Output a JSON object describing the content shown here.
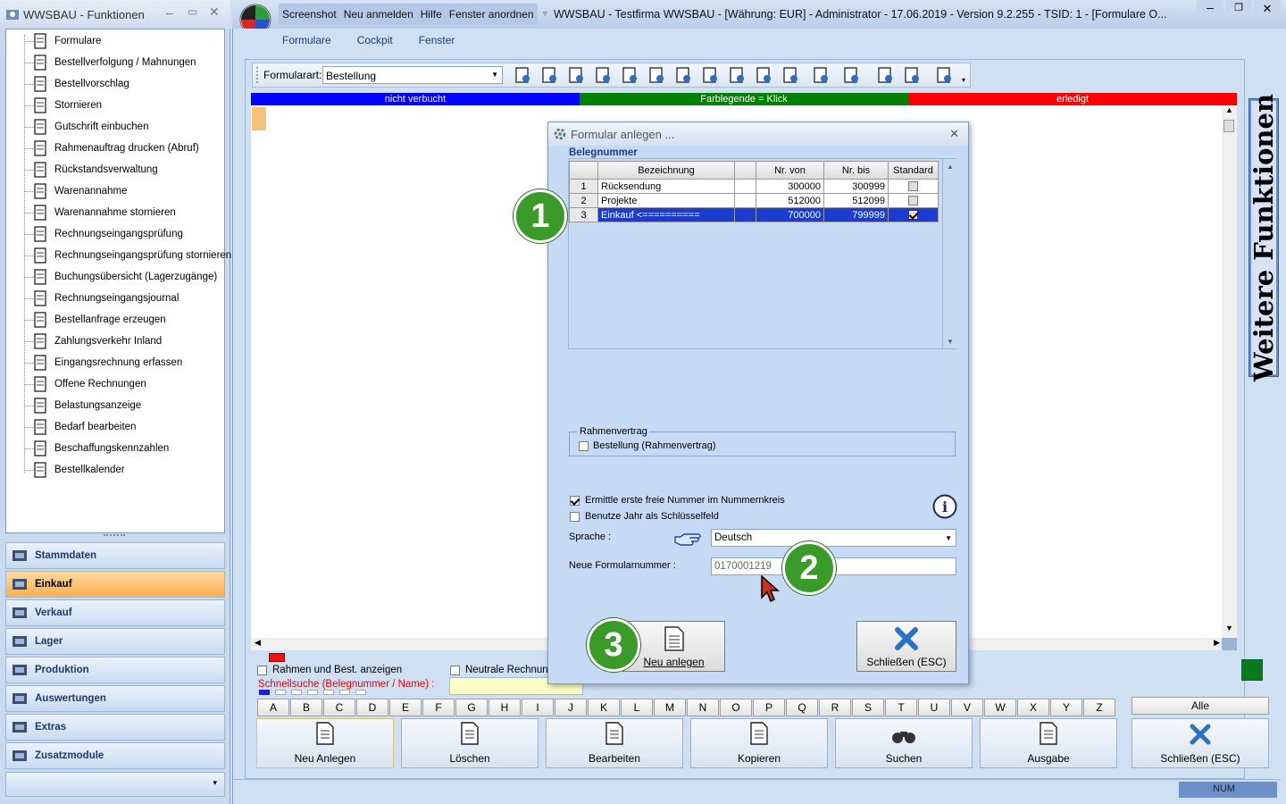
{
  "left_window": {
    "title": "WWSBAU - Funktionen",
    "tree_items": [
      "Formulare",
      "Bestellverfolgung / Mahnungen",
      "Bestellvorschlag",
      "Stornieren",
      "Gutschrift einbuchen",
      "Rahmenauftrag drucken (Abruf)",
      "Rückstandsverwaltung",
      "Warenannahme",
      "Warenannahme stornieren",
      "Rechnungseingangsprüfung",
      "Rechnungseingangsprüfung stornieren",
      "Buchungsübersicht (Lagerzugänge)",
      "Rechnungseingangsjournal",
      "Bestellanfrage erzeugen",
      "Zahlungsverkehr Inland",
      "Eingangsrechnung erfassen",
      "Offene Rechnungen",
      "Belastungsanzeige",
      "Bedarf bearbeiten",
      "Beschaffungskennzahlen",
      "Bestellkalender"
    ],
    "nav_groups": [
      "Stammdaten",
      "Einkauf",
      "Verkauf",
      "Lager",
      "Produktion",
      "Auswertungen",
      "Extras",
      "Zusatzmodule"
    ],
    "active_group": "Einkauf"
  },
  "main_window": {
    "top_menu": [
      "Screenshot",
      "Neu anmelden",
      "Hilfe",
      "Fenster anordnen"
    ],
    "title": "WWSBAU - Testfirma WWSBAU - [Währung: EUR] - Administrator - 17.06.2019 - Version 9.2.255 - TSID: 1 - [Formulare O...",
    "menu": [
      "Formulare",
      "Cockpit",
      "Fenster"
    ],
    "formularart_label": "Formularart:",
    "formularart_value": "Bestellung",
    "legend": [
      {
        "label": "nicht verbucht",
        "color": "#0000ff"
      },
      {
        "label": "Farblegende = Klick",
        "color": "#008000"
      },
      {
        "label": "erledigt",
        "color": "#ff0000"
      }
    ],
    "side_tab": "Weitere Funktionen",
    "checkbox_rahmen": "Rahmen und Best. anzeigen",
    "checkbox_neutral": "Neutrale Rechnung",
    "schnellsuche_label": "Schnellsuche (Belegnummer / Name) :",
    "letters": [
      "A",
      "B",
      "C",
      "D",
      "E",
      "F",
      "G",
      "H",
      "I",
      "J",
      "K",
      "L",
      "M",
      "N",
      "O",
      "P",
      "Q",
      "R",
      "S",
      "T",
      "U",
      "V",
      "W",
      "X",
      "Y",
      "Z"
    ],
    "alle_label": "Alle",
    "bottom_buttons": [
      "Neu Anlegen",
      "Löschen",
      "Bearbeiten",
      "Kopieren",
      "Suchen",
      "Ausgabe",
      "Schließen (ESC)"
    ],
    "status_num": "NUM"
  },
  "dialog": {
    "title": "Formular anlegen ...",
    "section": "Belegnummer",
    "columns": [
      "Bezeichnung",
      "Nr. von",
      "Nr. bis",
      "Standard"
    ],
    "rows": [
      {
        "nr": "1",
        "bezeichnung": "Rücksendung",
        "von": "300000",
        "bis": "300999",
        "standard": false
      },
      {
        "nr": "2",
        "bezeichnung": "Projekte",
        "von": "512000",
        "bis": "512099",
        "standard": false
      },
      {
        "nr": "3",
        "bezeichnung": "Einkauf  <==========",
        "von": "700000",
        "bis": "799999",
        "standard": true
      }
    ],
    "rahmen_group": "Rahmenvertrag",
    "rahmen_checkbox": "Bestellung (Rahmenvertrag)",
    "opt_ermittle": "Ermittle erste freie Nummer im Nummernkreis",
    "opt_ermittle_checked": true,
    "opt_jahr": "Benutze Jahr als Schlüsselfeld",
    "opt_jahr_checked": false,
    "sprache_label": "Sprache :",
    "sprache_value": "Deutsch",
    "neue_nr_label": "Neue Formularnummer :",
    "neue_nr_value": "0170001219",
    "btn_neu": "Neu anlegen",
    "btn_close": "Schließen (ESC)"
  },
  "badges": [
    "1",
    "2",
    "3"
  ]
}
